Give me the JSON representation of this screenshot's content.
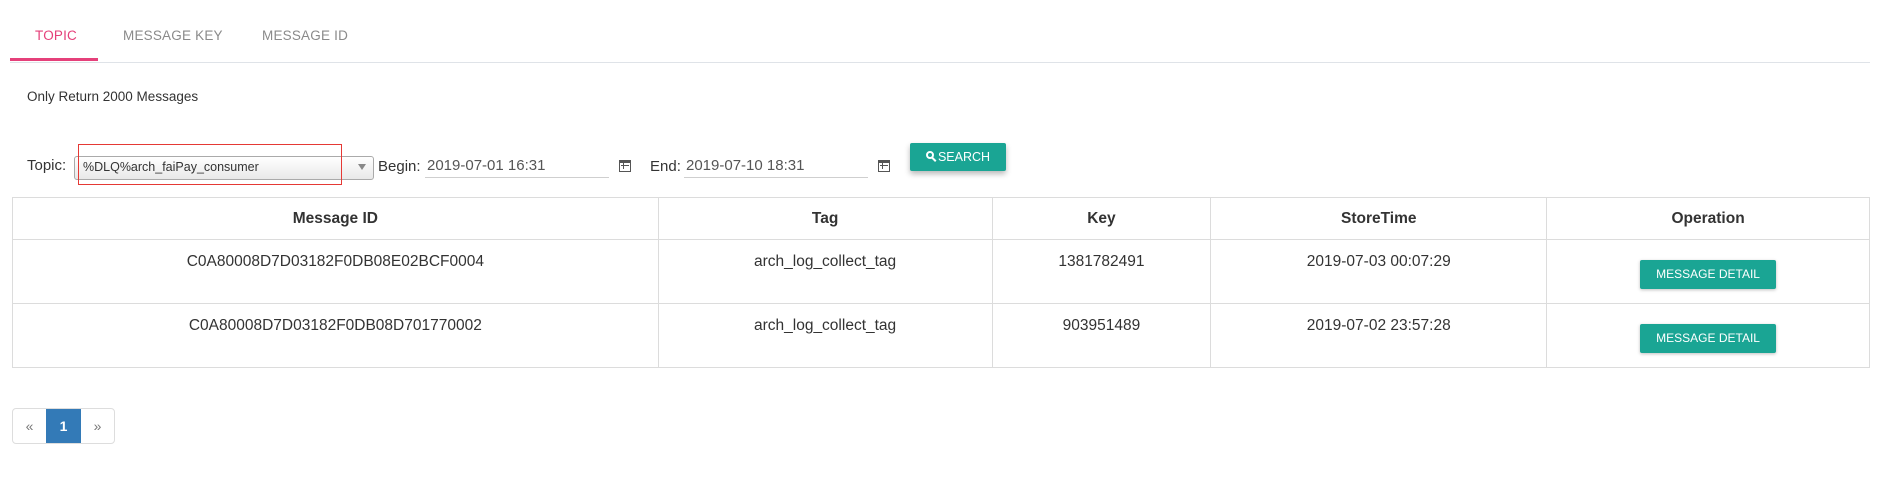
{
  "tabs": [
    {
      "label": "TOPIC",
      "active": true
    },
    {
      "label": "MESSAGE KEY",
      "active": false
    },
    {
      "label": "MESSAGE ID",
      "active": false
    }
  ],
  "notice": "Only Return 2000 Messages",
  "form": {
    "topic_label": "Topic:",
    "topic_value": "%DLQ%arch_faiPay_consumer",
    "begin_label": "Begin:",
    "begin_value": "2019-07-01 16:31",
    "end_label": "End:",
    "end_value": "2019-07-10 18:31",
    "search_label": "SEARCH"
  },
  "table": {
    "headers": [
      "Message ID",
      "Tag",
      "Key",
      "StoreTime",
      "Operation"
    ],
    "rows": [
      {
        "message_id": "C0A80008D7D03182F0DB08E02BCF0004",
        "tag": "arch_log_collect_tag",
        "key": "1381782491",
        "store_time": "2019-07-03 00:07:29",
        "action": "MESSAGE DETAIL"
      },
      {
        "message_id": "C0A80008D7D03182F0DB08D701770002",
        "tag": "arch_log_collect_tag",
        "key": "903951489",
        "store_time": "2019-07-02 23:57:28",
        "action": "MESSAGE DETAIL"
      }
    ]
  },
  "pagination": {
    "prev": "«",
    "current": "1",
    "next": "»"
  },
  "colors": {
    "accent": "#e5407a",
    "button": "#1aa594",
    "page_active": "#337ab7",
    "highlight_border": "#e53935"
  }
}
